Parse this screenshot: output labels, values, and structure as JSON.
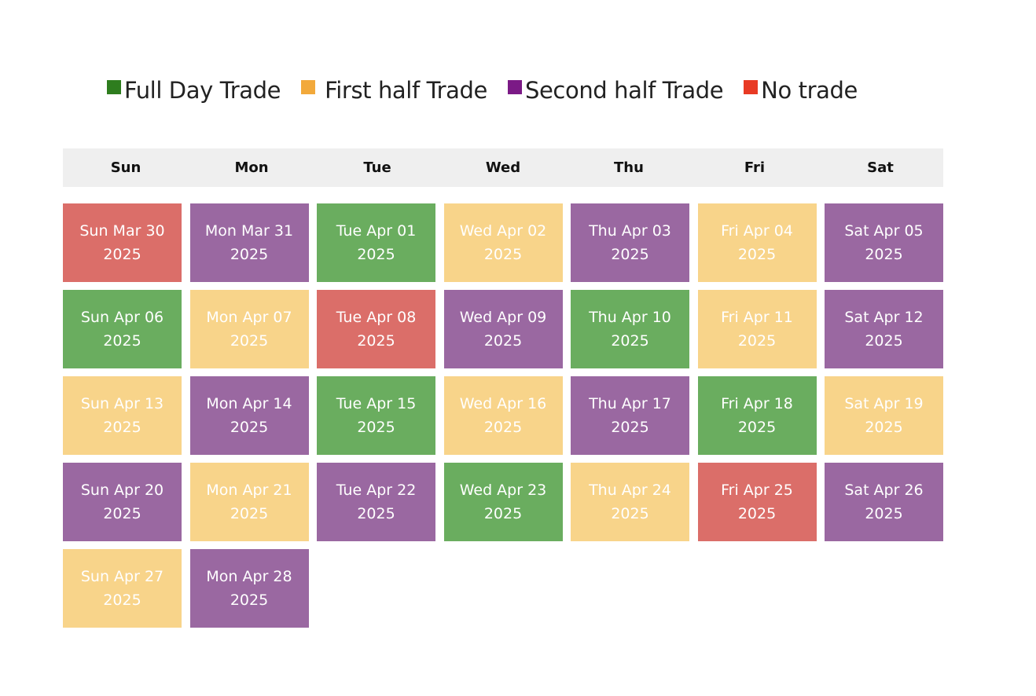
{
  "colors": {
    "legend": {
      "full_day": "#2e7d1e",
      "first_half": "#f2a93b",
      "second_half": "#7b1a86",
      "no_trade": "#e83a24"
    },
    "cells": {
      "full_day": "#6aad5f",
      "first_half": "#f8d48a",
      "second_half": "#9a68a1",
      "no_trade": "#db6e69"
    }
  },
  "legend": [
    {
      "key": "full_day",
      "label": "Full Day Trade",
      "color": "#2e7d1e"
    },
    {
      "key": "first_half",
      "label": "First half Trade",
      "color": "#f2a93b"
    },
    {
      "key": "second_half",
      "label": "Second half Trade",
      "color": "#7b1a86"
    },
    {
      "key": "no_trade",
      "label": "No trade",
      "color": "#e83a24"
    }
  ],
  "weekdays": [
    "Sun",
    "Mon",
    "Tue",
    "Wed",
    "Thu",
    "Fri",
    "Sat"
  ],
  "days": [
    {
      "label": "Sun Mar 30 2025",
      "status": "no_trade"
    },
    {
      "label": "Mon Mar 31 2025",
      "status": "second_half"
    },
    {
      "label": "Tue Apr 01 2025",
      "status": "full_day"
    },
    {
      "label": "Wed Apr 02 2025",
      "status": "first_half"
    },
    {
      "label": "Thu Apr 03 2025",
      "status": "second_half"
    },
    {
      "label": "Fri Apr 04 2025",
      "status": "first_half"
    },
    {
      "label": "Sat Apr 05 2025",
      "status": "second_half"
    },
    {
      "label": "Sun Apr 06 2025",
      "status": "full_day"
    },
    {
      "label": "Mon Apr 07 2025",
      "status": "first_half"
    },
    {
      "label": "Tue Apr 08 2025",
      "status": "no_trade"
    },
    {
      "label": "Wed Apr 09 2025",
      "status": "second_half"
    },
    {
      "label": "Thu Apr 10 2025",
      "status": "full_day"
    },
    {
      "label": "Fri Apr 11 2025",
      "status": "first_half"
    },
    {
      "label": "Sat Apr 12 2025",
      "status": "second_half"
    },
    {
      "label": "Sun Apr 13 2025",
      "status": "first_half"
    },
    {
      "label": "Mon Apr 14 2025",
      "status": "second_half"
    },
    {
      "label": "Tue Apr 15 2025",
      "status": "full_day"
    },
    {
      "label": "Wed Apr 16 2025",
      "status": "first_half"
    },
    {
      "label": "Thu Apr 17 2025",
      "status": "second_half"
    },
    {
      "label": "Fri Apr 18 2025",
      "status": "full_day"
    },
    {
      "label": "Sat Apr 19 2025",
      "status": "first_half"
    },
    {
      "label": "Sun Apr 20 2025",
      "status": "second_half"
    },
    {
      "label": "Mon Apr 21 2025",
      "status": "first_half"
    },
    {
      "label": "Tue Apr 22 2025",
      "status": "second_half"
    },
    {
      "label": "Wed Apr 23 2025",
      "status": "full_day"
    },
    {
      "label": "Thu Apr 24 2025",
      "status": "first_half"
    },
    {
      "label": "Fri Apr 25 2025",
      "status": "no_trade"
    },
    {
      "label": "Sat Apr 26 2025",
      "status": "second_half"
    },
    {
      "label": "Sun Apr 27 2025",
      "status": "first_half"
    },
    {
      "label": "Mon Apr 28 2025",
      "status": "second_half"
    }
  ]
}
